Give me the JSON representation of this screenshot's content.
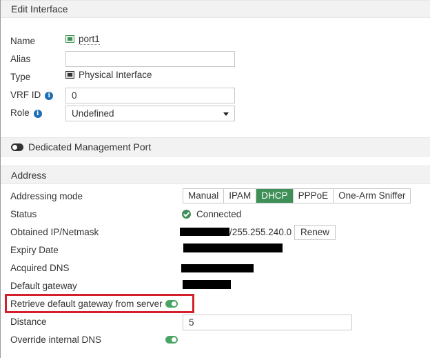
{
  "header": {
    "title": "Edit Interface"
  },
  "fields": {
    "name_label": "Name",
    "name_value": "port1",
    "alias_label": "Alias",
    "alias_value": "",
    "type_label": "Type",
    "type_value": "Physical Interface",
    "vrf_label": "VRF ID",
    "vrf_value": "0",
    "role_label": "Role",
    "role_value": "Undefined"
  },
  "mgmt": {
    "label": "Dedicated Management Port",
    "enabled": false
  },
  "address": {
    "section_title": "Address",
    "mode_label": "Addressing mode",
    "modes": [
      "Manual",
      "IPAM",
      "DHCP",
      "PPPoE",
      "One-Arm Sniffer"
    ],
    "active_mode": "DHCP",
    "status_label": "Status",
    "status_value": "Connected",
    "ip_label": "Obtained IP/Netmask",
    "ip_visible_suffix": "/255.255.240.0",
    "renew_label": "Renew",
    "expiry_label": "Expiry Date",
    "dns_label": "Acquired DNS",
    "gateway_label": "Default gateway",
    "retrieve_gateway_label": "Retrieve default gateway from server",
    "retrieve_gateway_enabled": true,
    "distance_label": "Distance",
    "distance_value": "5",
    "override_dns_label": "Override internal DNS",
    "override_dns_enabled": true
  },
  "colors": {
    "accent_green": "#3f8f58",
    "info_blue": "#1f6fb5",
    "highlight_red": "#d3202a"
  }
}
